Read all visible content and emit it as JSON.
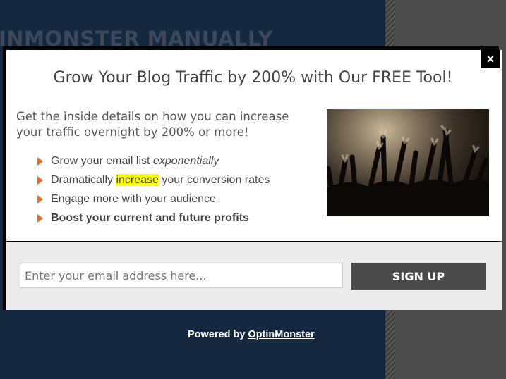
{
  "background": {
    "heading": "INMONSTER MANUALLY",
    "colors": {
      "navy": "#16283f",
      "gray": "#4b4b4b"
    }
  },
  "popup": {
    "close_icon": "×",
    "title": "Grow Your Blog Traffic by 200% with Our FREE Tool!",
    "lead": "Get the inside details on how you can increase your traffic overnight by 200% or more!",
    "benefits": [
      {
        "text_before": "Grow your email list ",
        "emphasis": "exponentially"
      },
      {
        "text_before": "Dramatically ",
        "highlight": "increase",
        "text_after": " your conversion rates"
      },
      {
        "text": "Engage more with your audience"
      },
      {
        "text": "Boost your current and future profits"
      }
    ],
    "image_icon": "concert-crowd-photo",
    "email_placeholder": "Enter your email address here...",
    "signup_label": "SIGN UP",
    "accent_color": "#f26722",
    "highlight_color": "#ffff00"
  },
  "footer": {
    "powered_prefix": "Powered by",
    "powered_link": "OptinMonster"
  }
}
